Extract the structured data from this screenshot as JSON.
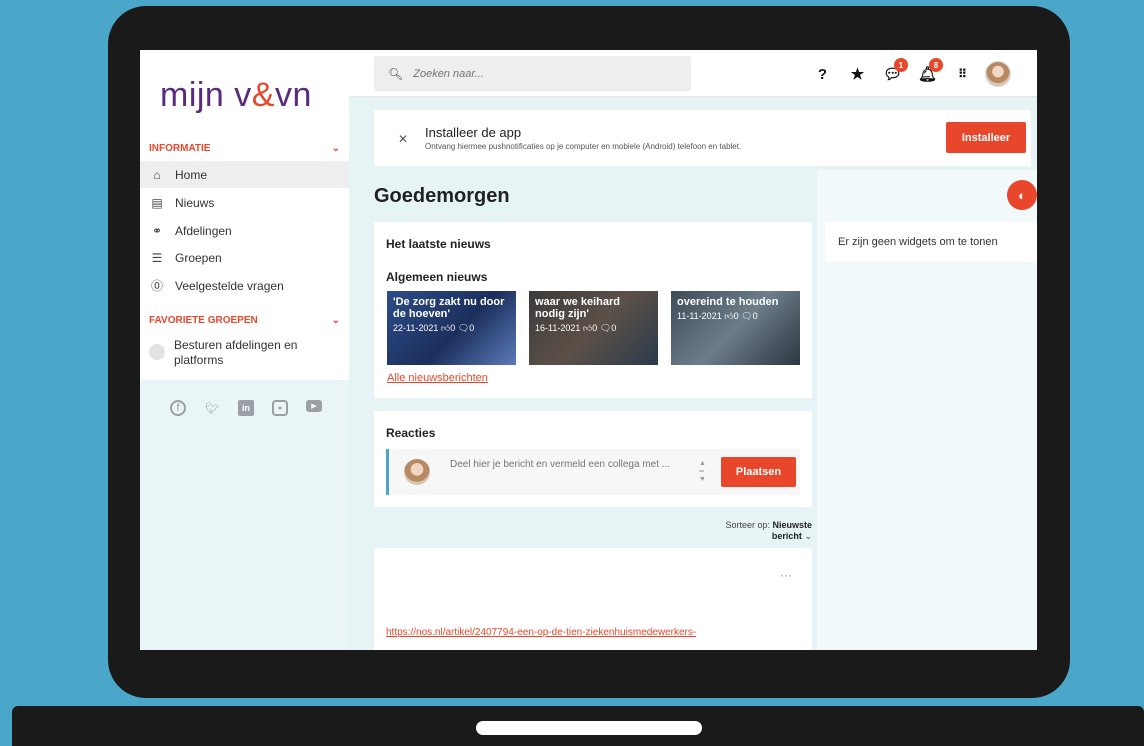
{
  "logo": {
    "part1": "mijn v",
    "amp": "&",
    "part2": "vn"
  },
  "sidebar": {
    "section_info": "INFORMATIE",
    "items": [
      {
        "label": "Home",
        "icon": "home-icon"
      },
      {
        "label": "Nieuws",
        "icon": "newspaper-icon"
      },
      {
        "label": "Afdelingen",
        "icon": "sitemap-icon"
      },
      {
        "label": "Groepen",
        "icon": "layers-icon"
      },
      {
        "label": "Veelgestelde vragen",
        "icon": "question-circle-icon"
      }
    ],
    "section_fav": "FAVORIETE GROEPEN",
    "fav_items": [
      {
        "label": "Besturen afdelingen en platforms"
      }
    ],
    "socials": [
      "facebook-icon",
      "twitter-icon",
      "linkedin-icon",
      "instagram-icon",
      "youtube-icon"
    ]
  },
  "topbar": {
    "search_placeholder": "Zoeken naar...",
    "chat_badge": "1",
    "notifications_badge": "8"
  },
  "banner": {
    "title": "Installeer de app",
    "subtitle": "Ontvang hiermee pushnotificaties op je computer en mobiele (Android) telefoon en tablet.",
    "button": "Installeer"
  },
  "greeting": "Goedemorgen",
  "news": {
    "card_title": "Het laatste nieuws",
    "section_title": "Algemeen nieuws",
    "tiles": [
      {
        "title": "'De zorg zakt nu door de hoeven'",
        "date": "22-11-2021",
        "likes": "0",
        "comments": "0"
      },
      {
        "title": "waar we keihard nodig zijn'",
        "date": "16-11-2021",
        "likes": "0",
        "comments": "0"
      },
      {
        "title": "overeind te houden",
        "date": "11-11-2021",
        "likes": "0",
        "comments": "0"
      }
    ],
    "all_link": "Alle nieuwsberichten"
  },
  "reactions": {
    "title": "Reacties",
    "placeholder": "Deel hier je bericht en vermeld een collega met ...",
    "button": "Plaatsen"
  },
  "sort": {
    "label": "Sorteer op:",
    "value": "Nieuwste bericht"
  },
  "post": {
    "link": "https://nos.nl/artikel/2407794-een-op-de-tien-ziekenhuismedewerkers-"
  },
  "widgets": {
    "empty_text": "Er zijn geen widgets om te tonen"
  },
  "colors": {
    "accent": "#e8472b",
    "brand": "#5a2a7f",
    "background": "#4aa7c9"
  }
}
